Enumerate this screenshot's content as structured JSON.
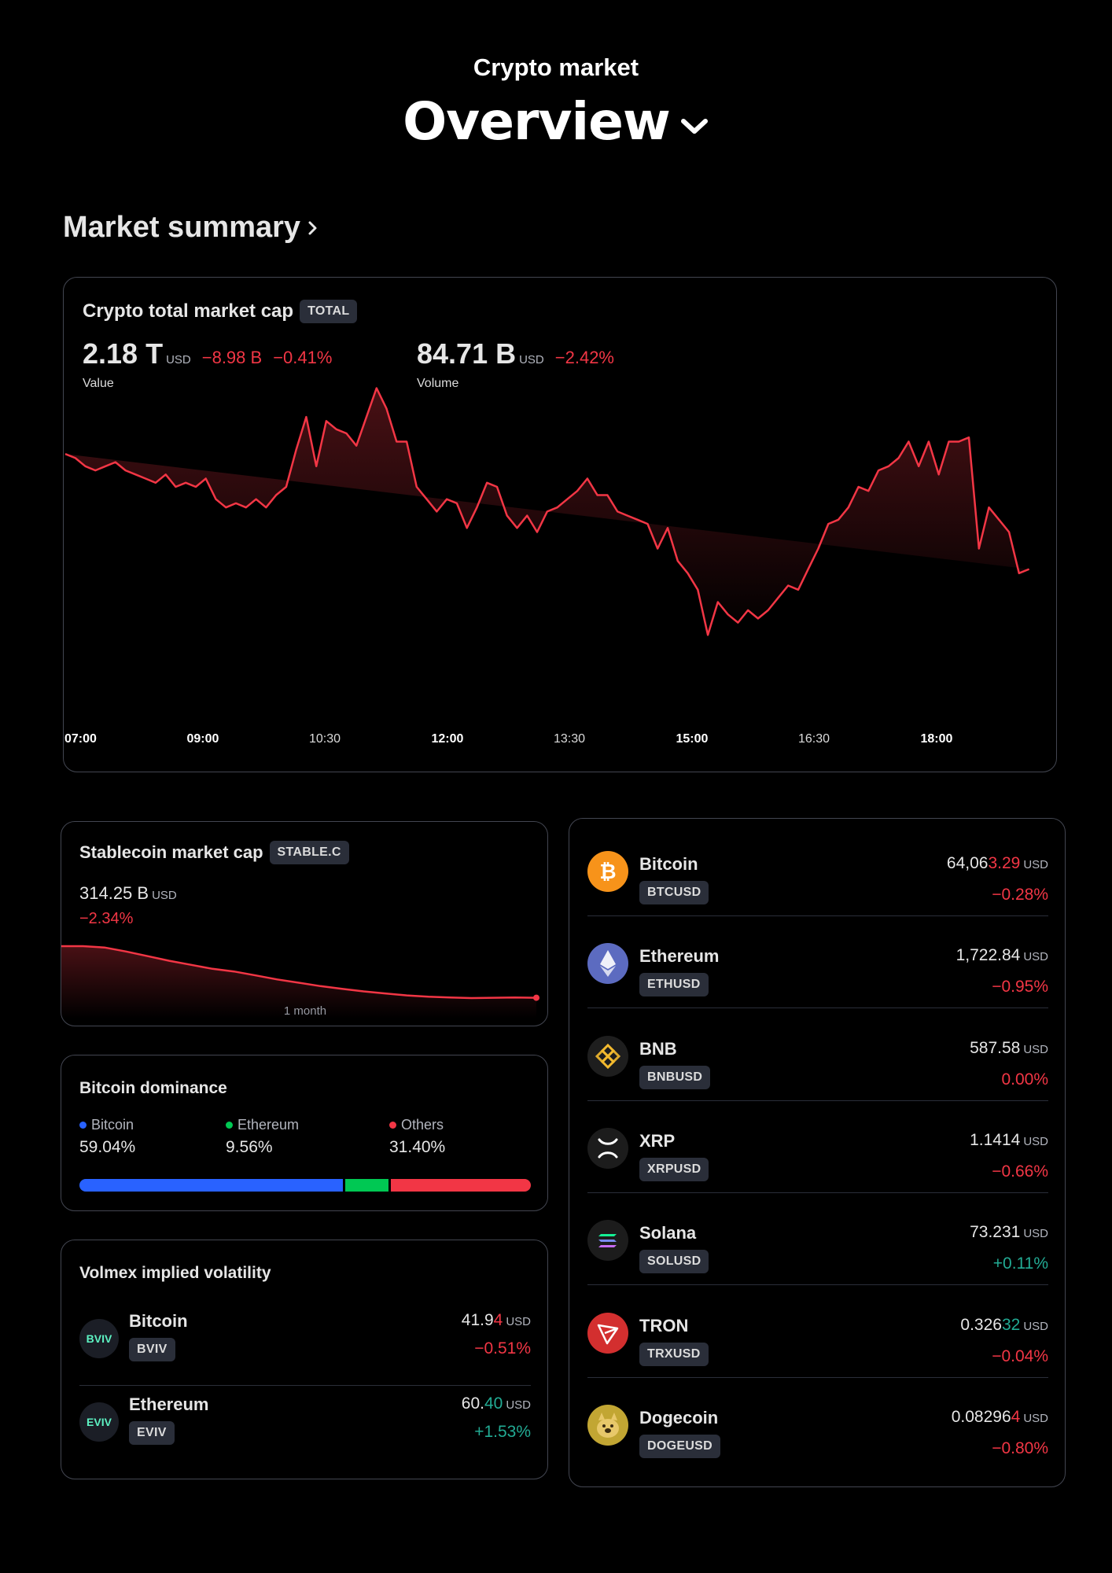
{
  "header": {
    "subtitle": "Crypto market",
    "title": "Overview"
  },
  "section": {
    "title": "Market summary"
  },
  "total_card": {
    "title": "Crypto total market cap",
    "badge": "TOTAL",
    "value": "2.18 T",
    "value_unit": "USD",
    "value_change_abs": "−8.98 B",
    "value_change_pct": "−0.41%",
    "value_label": "Value",
    "volume": "84.71 B",
    "volume_unit": "USD",
    "volume_change_pct": "−2.42%",
    "volume_label": "Volume"
  },
  "chart_data": {
    "type": "area",
    "title": "Crypto total market cap",
    "x_ticks": [
      "07:00",
      "09:00",
      "10:30",
      "12:00",
      "13:30",
      "15:00",
      "16:30",
      "18:00"
    ],
    "x": [
      0,
      10,
      20,
      30,
      40,
      50,
      60,
      70,
      80,
      90,
      100,
      110,
      120,
      130,
      140,
      150,
      160,
      170,
      180,
      190,
      200,
      210,
      220,
      230,
      240,
      250,
      260,
      270,
      280,
      290,
      300,
      310,
      320,
      330,
      340,
      350,
      360,
      370,
      380,
      390,
      400,
      410,
      420,
      430,
      440,
      450,
      460,
      470,
      480,
      490,
      500,
      510,
      520,
      530,
      540,
      550,
      560,
      570,
      580,
      590,
      600,
      610,
      620,
      630,
      640,
      650,
      660,
      670,
      680,
      690,
      700,
      710,
      720,
      730,
      740,
      750,
      760,
      770,
      780,
      790,
      800,
      810,
      820,
      830,
      840,
      850,
      860,
      870,
      880,
      890,
      900,
      910,
      920,
      930,
      940,
      950,
      960,
      965
    ],
    "values": [
      2.187,
      2.186,
      2.184,
      2.183,
      2.184,
      2.185,
      2.183,
      2.182,
      2.181,
      2.18,
      2.182,
      2.179,
      2.18,
      2.179,
      2.181,
      2.176,
      2.174,
      2.175,
      2.174,
      2.176,
      2.174,
      2.177,
      2.179,
      2.188,
      2.196,
      2.184,
      2.195,
      2.193,
      2.192,
      2.189,
      2.196,
      2.203,
      2.198,
      2.19,
      2.19,
      2.179,
      2.176,
      2.173,
      2.176,
      2.175,
      2.169,
      2.174,
      2.18,
      2.179,
      2.172,
      2.169,
      2.172,
      2.168,
      2.173,
      2.174,
      2.176,
      2.178,
      2.181,
      2.177,
      2.177,
      2.173,
      2.172,
      2.171,
      2.17,
      2.164,
      2.169,
      2.161,
      2.158,
      2.154,
      2.143,
      2.151,
      2.148,
      2.146,
      2.149,
      2.147,
      2.149,
      2.152,
      2.155,
      2.154,
      2.159,
      2.164,
      2.17,
      2.171,
      2.174,
      2.179,
      2.178,
      2.183,
      2.184,
      2.186,
      2.19,
      2.184,
      2.19,
      2.182,
      2.19,
      2.19,
      2.191,
      2.164,
      2.174,
      2.171,
      2.168,
      2.158,
      2.159
    ],
    "ylim": [
      2.14,
      2.205
    ],
    "series_color": "#f23645",
    "grid": false
  },
  "stable_card": {
    "title": "Stablecoin market cap",
    "badge": "STABLE.C",
    "value": "314.25 B",
    "unit": "USD",
    "change": "−2.34%",
    "period": "1 month",
    "series": [
      322.0,
      322.0,
      321.8,
      321.2,
      320.5,
      319.8,
      319.2,
      318.6,
      318.2,
      317.6,
      317.0,
      316.5,
      316.0,
      315.6,
      315.2,
      314.9,
      314.6,
      314.4,
      314.3,
      314.2,
      314.25,
      314.3,
      314.25
    ]
  },
  "dominance": {
    "title": "Bitcoin dominance",
    "items": [
      {
        "name": "Bitcoin",
        "pct": "59.04%",
        "value": 59.04,
        "color": "#2962ff"
      },
      {
        "name": "Ethereum",
        "pct": "9.56%",
        "value": 9.56,
        "color": "#00c853"
      },
      {
        "name": "Others",
        "pct": "31.40%",
        "value": 31.4,
        "color": "#f23645"
      }
    ]
  },
  "volmex": {
    "title": "Volmex implied volatility",
    "rows": [
      {
        "logo": "BVIV",
        "name": "Bitcoin",
        "badge": "BVIV",
        "price_main": "41.9",
        "price_tick": "4",
        "tick_dir": "neg",
        "unit": "USD",
        "change": "−0.51%",
        "dir": "neg"
      },
      {
        "logo": "EVIV",
        "name": "Ethereum",
        "badge": "EVIV",
        "price_main": "60.",
        "price_tick": "40",
        "tick_dir": "pos",
        "unit": "USD",
        "change": "+1.53%",
        "dir": "pos"
      }
    ]
  },
  "coins": [
    {
      "name": "Bitcoin",
      "badge": "BTCUSD",
      "price_main": "64,06",
      "price_tick": "3.29",
      "tick_dir": "neg",
      "unit": "USD",
      "change": "−0.28%",
      "dir": "neg",
      "icon": "bitcoin-icon",
      "color": "#f7931a"
    },
    {
      "name": "Ethereum",
      "badge": "ETHUSD",
      "price_main": "1,722.84",
      "price_tick": "",
      "tick_dir": "",
      "unit": "USD",
      "change": "−0.95%",
      "dir": "neg",
      "icon": "ethereum-icon",
      "color": "#5c6bc0"
    },
    {
      "name": "BNB",
      "badge": "BNBUSD",
      "price_main": "587.58",
      "price_tick": "",
      "tick_dir": "",
      "unit": "USD",
      "change": "0.00%",
      "dir": "neg",
      "icon": "bnb-icon",
      "color": "#1b1b1b"
    },
    {
      "name": "XRP",
      "badge": "XRPUSD",
      "price_main": "1.1414",
      "price_tick": "",
      "tick_dir": "",
      "unit": "USD",
      "change": "−0.66%",
      "dir": "neg",
      "icon": "xrp-icon",
      "color": "#1c1c1c"
    },
    {
      "name": "Solana",
      "badge": "SOLUSD",
      "price_main": "73.231",
      "price_tick": "",
      "tick_dir": "",
      "unit": "USD",
      "change": "+0.11%",
      "dir": "pos",
      "icon": "solana-icon",
      "color": "#1c1c1c"
    },
    {
      "name": "TRON",
      "badge": "TRXUSD",
      "price_main": "0.326",
      "price_tick": "32",
      "tick_dir": "pos",
      "unit": "USD",
      "change": "−0.04%",
      "dir": "neg",
      "icon": "tron-icon",
      "color": "#d32f2f"
    },
    {
      "name": "Dogecoin",
      "badge": "DOGEUSD",
      "price_main": "0.08296",
      "price_tick": "4",
      "tick_dir": "neg",
      "unit": "USD",
      "change": "−0.80%",
      "dir": "neg",
      "icon": "dogecoin-icon",
      "color": "#c2a633"
    }
  ]
}
